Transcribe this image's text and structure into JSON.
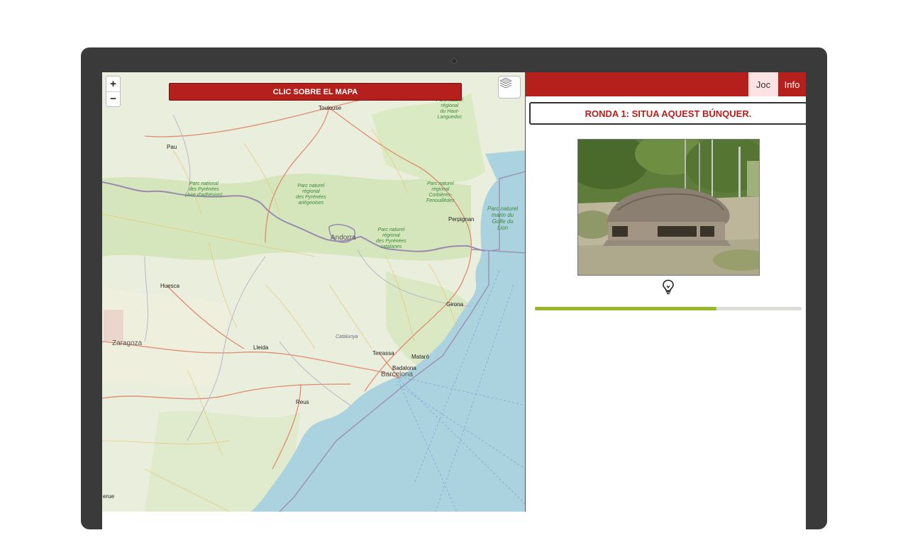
{
  "map": {
    "zoom_in": "+",
    "zoom_out": "−",
    "banner": "CLIC SOBRE EL MAPA",
    "layers_icon": "layers-icon",
    "labels": {
      "toulouse": "Toulouse",
      "pau": "Pau",
      "andorra": "Andorra",
      "perpignan": "Perpignan",
      "huesca": "Huesca",
      "zaragoza": "Zaragoza",
      "lleida": "Lleida",
      "girona": "Girona",
      "catalunya": "Catalunya",
      "terrassa": "Terrassa",
      "mataro": "Mataró",
      "badalona": "Badalona",
      "barcelona": "Barcelona",
      "reus": "Reus",
      "teruel": "erue",
      "park_pyrenees": "Parc national\ndes Pyrénées\n(Aire d'adhésion)",
      "park_ariegeoises": "Parc naturel\nrégional\ndes Pyrénées\nariégeoises",
      "park_catalanes": "Parc naturel\nrégional\ndes Pyrénées\ncatalanes",
      "park_corbieres": "Parc naturel\nrégional\nCorbières-\nFenouillèdes",
      "park_hautlanguedoc": "Parc naturel\nrégional\ndu Haut-\nLanguedoc",
      "park_marin": "Parc naturel\nmarin du\nGolfe du\nLion"
    }
  },
  "panel": {
    "tabs": {
      "joc": "Joc",
      "info": "Info"
    },
    "round_title": "RONDA 1: SITUA AQUEST BÚNQUER.",
    "hint_icon": "lightbulb-icon",
    "progress_fraction": 0.68,
    "colors": {
      "brand": "#b51f1c",
      "progress": "#9bb726"
    }
  }
}
